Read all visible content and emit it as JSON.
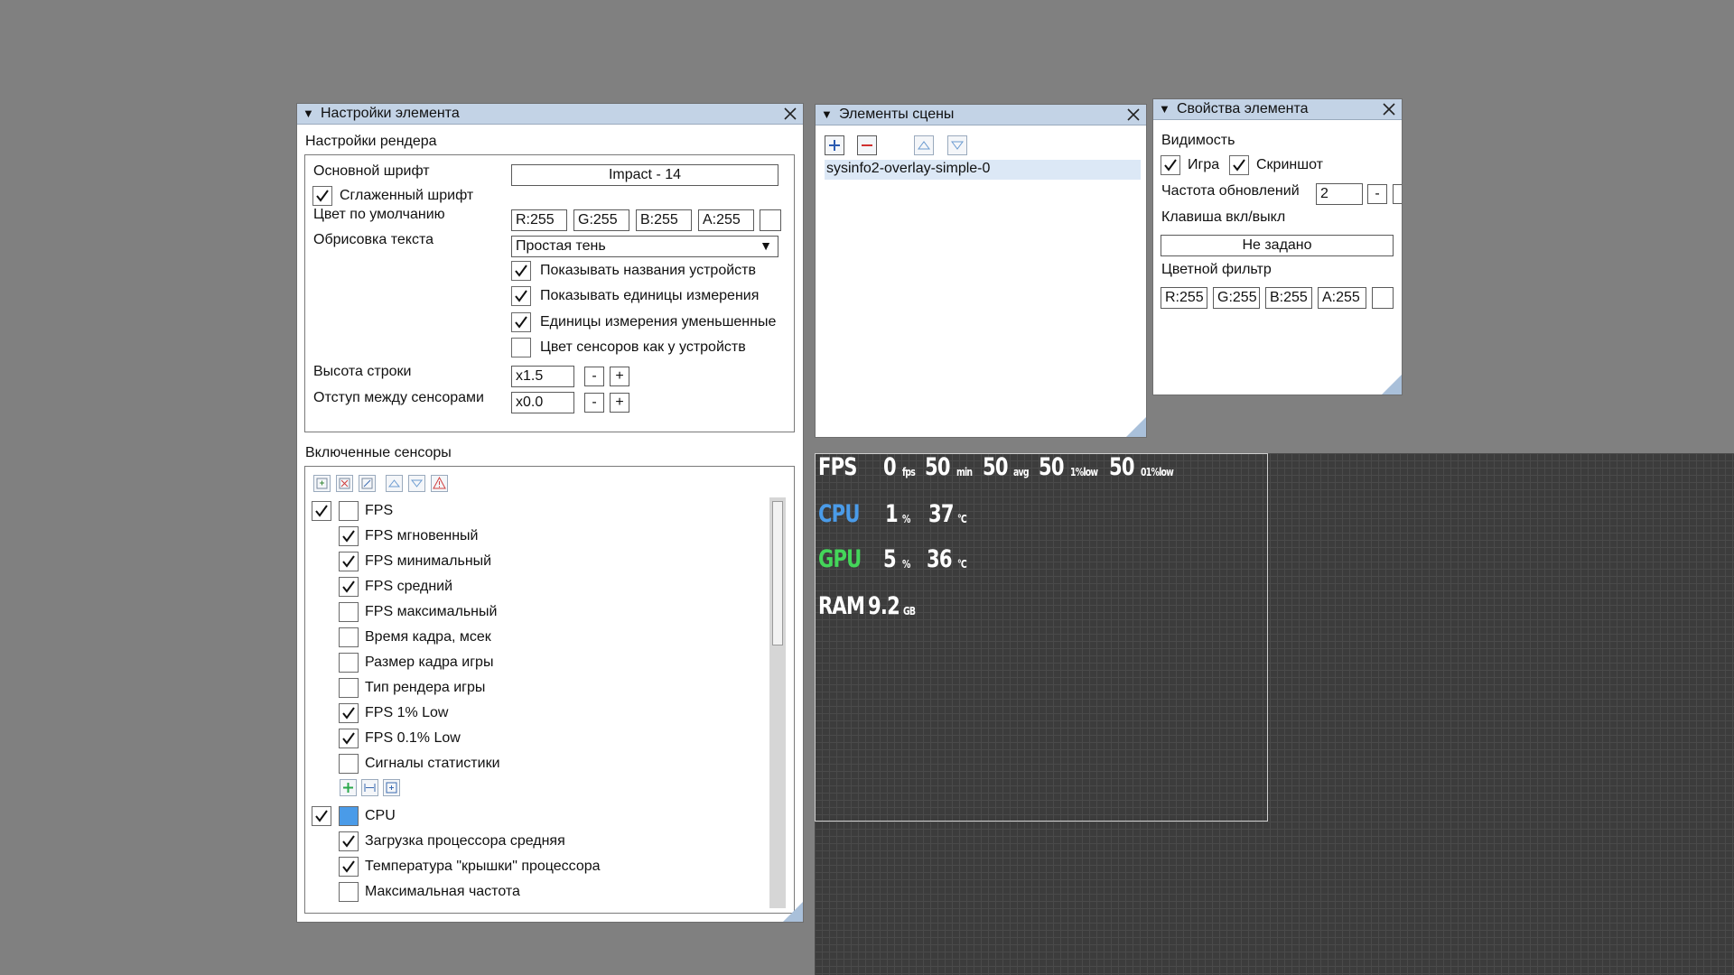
{
  "colors": {
    "background": "#808080",
    "panel": "#ffffff",
    "titlebar": "#c3d3e6",
    "cpu_accent": "#4a9be8",
    "gpu_accent": "#44d65a",
    "overlay_bg": "#3c3c3c"
  },
  "settings_panel": {
    "title": "Настройки элемента",
    "render_section": "Настройки рендера",
    "font_label": "Основной шрифт",
    "font_value": "Impact - 14",
    "smooth_font": {
      "label": "Сглаженный шрифт",
      "checked": true
    },
    "default_color_label": "Цвет по умолчанию",
    "default_color": {
      "r": "R:255",
      "g": "G:255",
      "b": "B:255",
      "a": "A:255"
    },
    "outline_label": "Обрисовка текста",
    "outline_value": "Простая тень",
    "options": [
      {
        "label": "Показывать названия устройств",
        "checked": true
      },
      {
        "label": "Показывать единицы измерения",
        "checked": true
      },
      {
        "label": "Единицы измерения уменьшенные",
        "checked": true
      },
      {
        "label": "Цвет сенсоров как у устройств",
        "checked": false
      }
    ],
    "line_height_label": "Высота строки",
    "line_height_value": "x1.5",
    "spacing_label": "Отступ между сенсорами",
    "spacing_value": "x0.0",
    "minus": "-",
    "plus": "+",
    "sensors_section": "Включенные сенсоры",
    "fps_group": {
      "label": "FPS",
      "checked": true
    },
    "fps_items": [
      {
        "label": "FPS мгновенный",
        "checked": true
      },
      {
        "label": "FPS минимальный",
        "checked": true
      },
      {
        "label": "FPS средний",
        "checked": true
      },
      {
        "label": "FPS максимальный",
        "checked": false
      },
      {
        "label": "Время кадра, мсек",
        "checked": false
      },
      {
        "label": "Размер кадра игры",
        "checked": false
      },
      {
        "label": "Тип рендера игры",
        "checked": false
      },
      {
        "label": "FPS 1% Low",
        "checked": true
      },
      {
        "label": "FPS 0.1% Low",
        "checked": true
      },
      {
        "label": "Сигналы статистики",
        "checked": false
      }
    ],
    "cpu_group": {
      "label": "CPU",
      "checked": true
    },
    "cpu_items": [
      {
        "label": "Загрузка процессора средняя",
        "checked": true
      },
      {
        "label": "Температура \"крышки\" процессора",
        "checked": true
      },
      {
        "label": "Максимальная частота",
        "checked": false
      }
    ]
  },
  "scene_panel": {
    "title": "Элементы сцены",
    "items": [
      "sysinfo2-overlay-simple-0"
    ]
  },
  "props_panel": {
    "title": "Свойства элемента",
    "visibility_label": "Видимость",
    "game": {
      "label": "Игра",
      "checked": true
    },
    "screenshot": {
      "label": "Скриншот",
      "checked": true
    },
    "update_rate_label": "Частота обновлений",
    "update_rate_value": "2",
    "minus": "-",
    "hotkey_label": "Клавиша вкл/выкл",
    "hotkey_value": "Не задано",
    "filter_label": "Цветной фильтр",
    "filter": {
      "r": "R:255",
      "g": "G:255",
      "b": "B:255",
      "a": "A:255"
    }
  },
  "overlay": {
    "fps": {
      "label": "FPS",
      "v1": "0",
      "u1": "fps",
      "v2": "50",
      "u2": "min",
      "v3": "50",
      "u3": "avg",
      "v4": "50",
      "u4": "1%low",
      "v5": "50",
      "u5": "01%low"
    },
    "cpu": {
      "label": "CPU",
      "load": "1",
      "load_unit": "%",
      "temp": "37",
      "temp_unit": "°C"
    },
    "gpu": {
      "label": "GPU",
      "load": "5",
      "load_unit": "%",
      "temp": "36",
      "temp_unit": "°C"
    },
    "ram": {
      "label": "RAM",
      "value": "9.2",
      "unit": "GB"
    }
  }
}
